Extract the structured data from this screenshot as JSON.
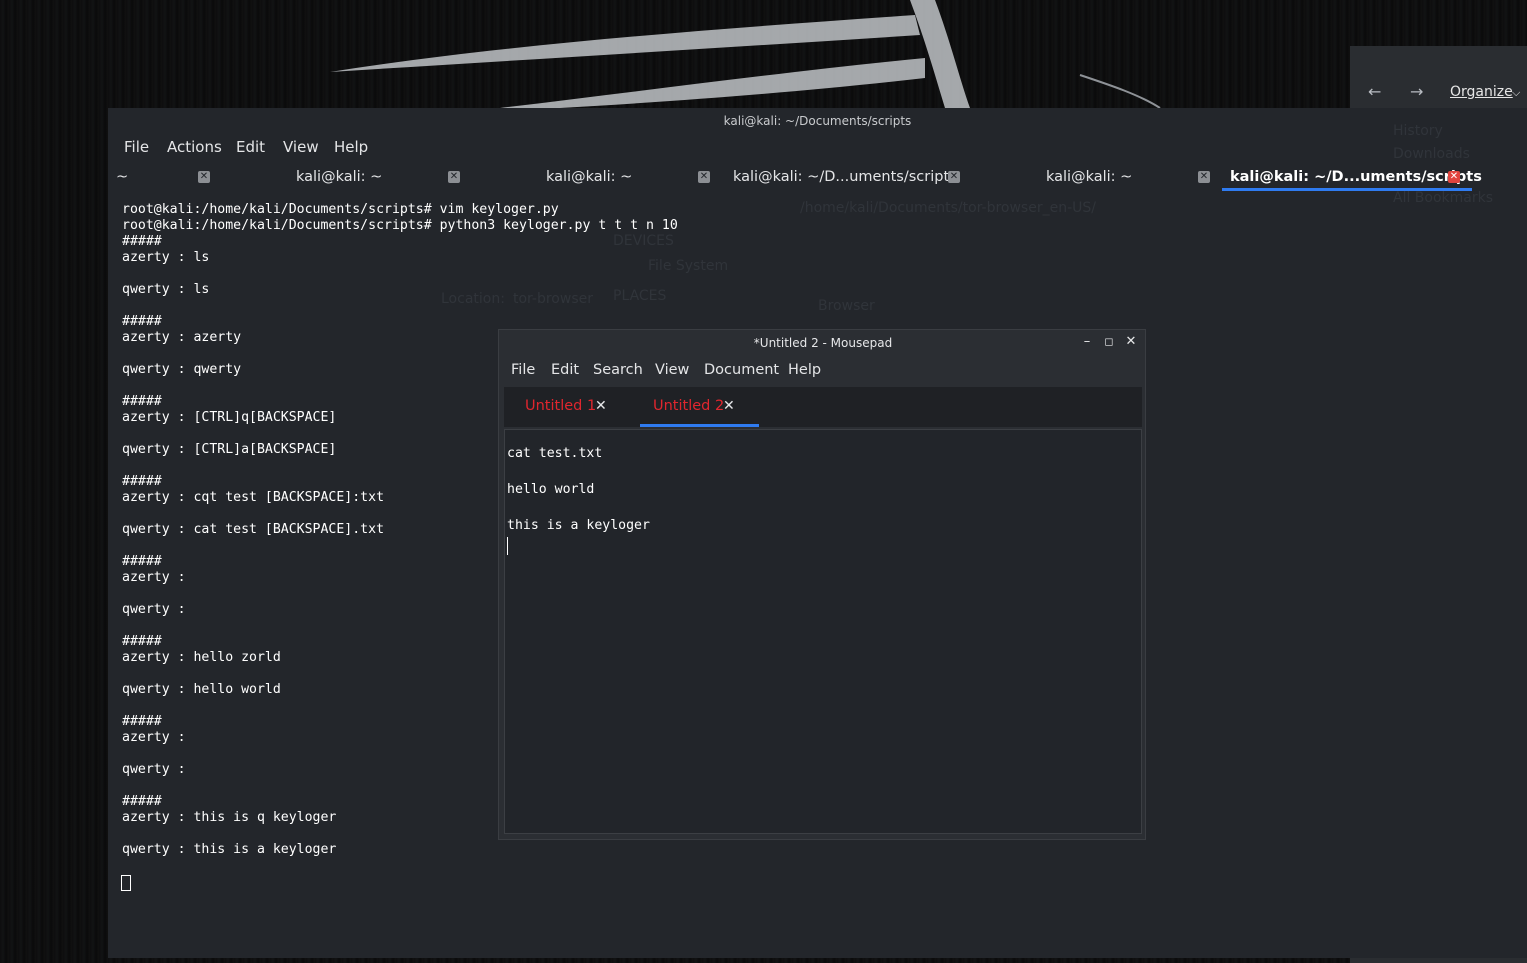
{
  "terminal": {
    "window_title": "kali@kali: ~/Documents/scripts",
    "menu": [
      "File",
      "Actions",
      "Edit",
      "View",
      "Help"
    ],
    "tabs": [
      {
        "label": "~"
      },
      {
        "label": "kali@kali: ~"
      },
      {
        "label": "kali@kali: ~"
      },
      {
        "label": "kali@kali: ~/D...uments/scripts"
      },
      {
        "label": "kali@kali: ~"
      },
      {
        "label": "kali@kali: ~/D...uments/scripts",
        "active": true
      }
    ],
    "lines": [
      "root@kali:/home/kali/Documents/scripts# vim keyloger.py",
      "root@kali:/home/kali/Documents/scripts# python3 keyloger.py t t t n 10",
      "#####",
      "azerty : ls",
      "",
      "qwerty : ls",
      "",
      "#####",
      "azerty : azerty",
      "",
      "qwerty : qwerty",
      "",
      "#####",
      "azerty : [CTRL]q[BACKSPACE]",
      "",
      "qwerty : [CTRL]a[BACKSPACE]",
      "",
      "#####",
      "azerty : cqt test [BACKSPACE]:txt",
      "",
      "qwerty : cat test [BACKSPACE].txt",
      "",
      "#####",
      "azerty :",
      "",
      "qwerty :",
      "",
      "#####",
      "azerty : hello zorld",
      "",
      "qwerty : hello world",
      "",
      "#####",
      "azerty :",
      "",
      "qwerty :",
      "",
      "#####",
      "azerty : this is q keyloger",
      "",
      "qwerty : this is a keyloger"
    ]
  },
  "mousepad": {
    "window_title": "*Untitled 2 - Mousepad",
    "menu": [
      "File",
      "Edit",
      "Search",
      "View",
      "Document",
      "Help"
    ],
    "tabs": [
      {
        "label": "Untitled 1"
      },
      {
        "label": "Untitled 2",
        "active": true
      }
    ],
    "content_lines": [
      "cat test.txt",
      "",
      "hello world",
      "",
      "this is a keyloger"
    ]
  },
  "file_browser": {
    "organize_label": "Organize",
    "back_icon": "arrow-left-icon",
    "forward_icon": "arrow-right-icon"
  },
  "colors": {
    "accent": "#2f7bf0",
    "tab_close_active": "#e0443e",
    "mousepad_tab_text": "#e0262e",
    "terminal_bg": "#23262b"
  }
}
